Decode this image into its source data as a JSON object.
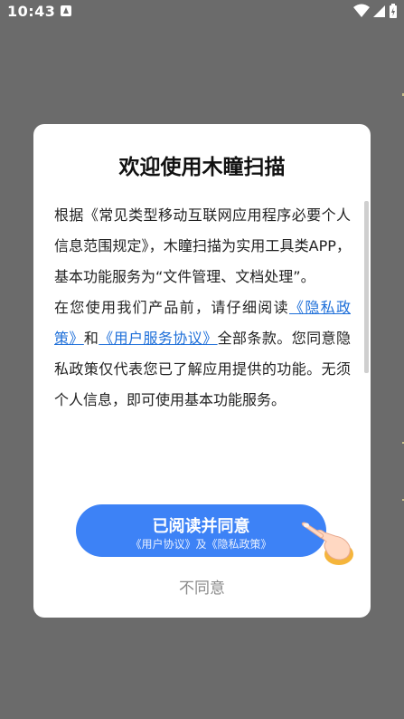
{
  "status_bar": {
    "time": "10:43"
  },
  "dialog": {
    "title": "欢迎使用木瞳扫描",
    "para1": "根据《常见类型移动互联网应用程序必要个人信息范围规定》，木瞳扫描为实用工具类APP，基本功能服务为“文件管理、文档处理”。",
    "para2_prefix": "在您使用我们产品前，请仔细阅读",
    "privacy_link": "《隐私政策》",
    "and_text": "和",
    "user_agreement_link": "《用户服务协议》",
    "para2_suffix": "全部条款。您同意隐私政策仅代表您已了解应用提供的功能。无须个人信息，即可使用基本功能服务。",
    "agree_button": {
      "label": "已阅读并同意",
      "sub_label": "《用户协议》及《隐私政策》"
    },
    "disagree_label": "不同意"
  },
  "colors": {
    "overlay": "#6b6b6b",
    "accent": "#3d82f6",
    "link": "#1e6fd9"
  }
}
